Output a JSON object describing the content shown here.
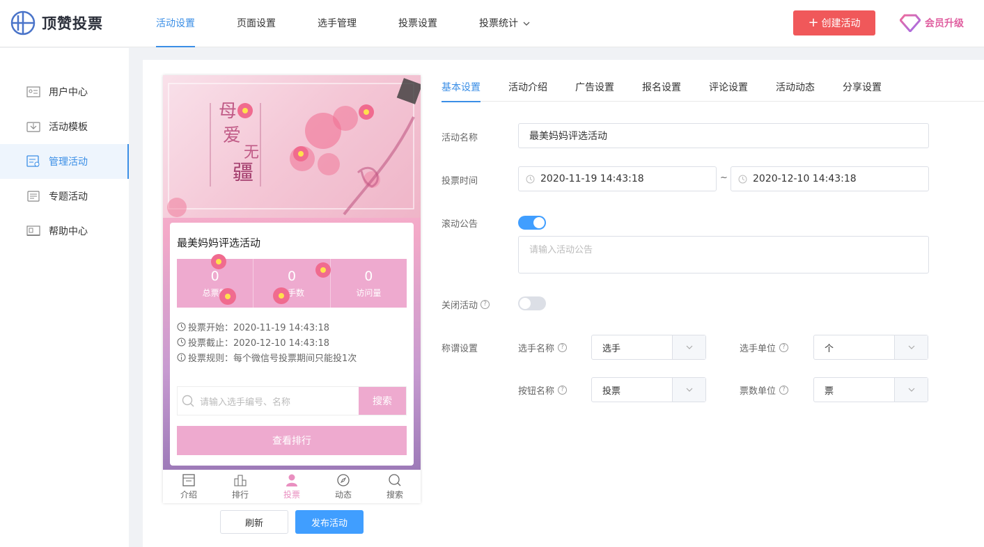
{
  "app": {
    "logo_text": "顶赞投票"
  },
  "nav": {
    "items": [
      "活动设置",
      "页面设置",
      "选手管理",
      "投票设置",
      "投票统计"
    ],
    "active_index": 0
  },
  "header": {
    "create_label": "创建活动",
    "vip_label": "会员升级"
  },
  "sidebar": {
    "items": [
      {
        "label": "用户中心",
        "icon": "user-card-icon"
      },
      {
        "label": "活动模板",
        "icon": "template-icon"
      },
      {
        "label": "管理活动",
        "icon": "manage-icon"
      },
      {
        "label": "专题活动",
        "icon": "topic-icon"
      },
      {
        "label": "帮助中心",
        "icon": "help-icon"
      }
    ],
    "active_index": 2
  },
  "preview": {
    "activity_title": "最美妈妈评选活动",
    "stats": [
      {
        "value": "0",
        "label": "总票数"
      },
      {
        "value": "0",
        "label": "选手数"
      },
      {
        "value": "0",
        "label": "访问量"
      }
    ],
    "vote_start": "投票开始：2020-11-19 14:43:18",
    "vote_end": "投票截止：2020-12-10 14:43:18",
    "vote_rule": "投票规则：每个微信号投票期间只能投1次",
    "search_placeholder": "请输入选手编号、名称",
    "search_button": "搜索",
    "ranking_button": "查看排行",
    "tabbar": [
      "介绍",
      "排行",
      "投票",
      "动态",
      "搜索"
    ],
    "tabbar_active": 2
  },
  "actions": {
    "refresh": "刷新",
    "publish": "发布活动"
  },
  "settings": {
    "tabs": [
      "基本设置",
      "活动介绍",
      "广告设置",
      "报名设置",
      "评论设置",
      "活动动态",
      "分享设置"
    ],
    "active_tab": 0,
    "name_label": "活动名称",
    "name_value": "最美妈妈评选活动",
    "time_label": "投票时间",
    "time_start": "2020-11-19 14:43:18",
    "time_sep": "~",
    "time_end": "2020-12-10 14:43:18",
    "notice_label": "滚动公告",
    "notice_enabled": true,
    "notice_placeholder": "请输入活动公告",
    "close_label": "关闭活动",
    "close_enabled": false,
    "title_label": "称谓设置",
    "player_name_label": "选手名称",
    "player_name_value": "选手",
    "player_unit_label": "选手单位",
    "player_unit_value": "个",
    "button_name_label": "按钮名称",
    "button_name_value": "投票",
    "vote_unit_label": "票数单位",
    "vote_unit_value": "票"
  },
  "colors": {
    "accent": "#3a8ee6",
    "create": "#f0585a",
    "pink": "#eeaacf",
    "vip": "#e05fa0"
  }
}
